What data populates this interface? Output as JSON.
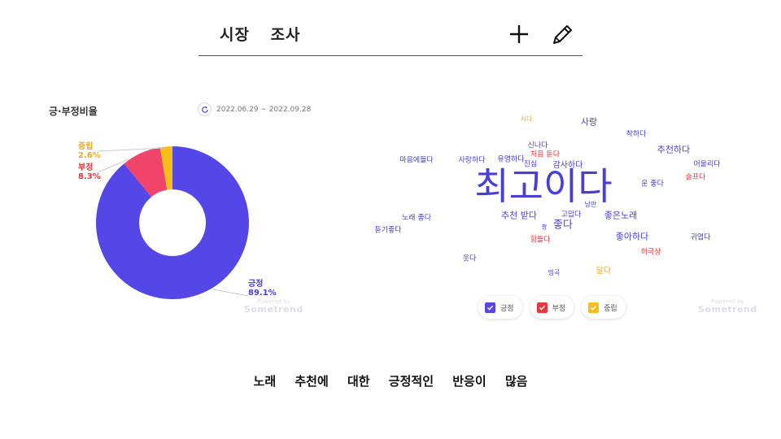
{
  "header": {
    "title": "시장 조사"
  },
  "sentiment_panel": {
    "title": "긍·부정비율",
    "date_range": "2022.06.29 ~ 2022.09.28"
  },
  "chart_data": [
    {
      "type": "pie",
      "title": "긍·부정비율",
      "slices": [
        {
          "label": "긍정",
          "value": 89.1,
          "value_label": "89.1%",
          "color": "#5546e8"
        },
        {
          "label": "부정",
          "value": 8.3,
          "value_label": "8.3%",
          "color": "#f0446b"
        },
        {
          "label": "중립",
          "value": 2.6,
          "value_label": "2.6%",
          "color": "#f5be18"
        }
      ]
    }
  ],
  "wordcloud": {
    "words": [
      {
        "text": "최고이다",
        "sentiment": "positive"
      },
      {
        "text": "좋다",
        "sentiment": "positive"
      },
      {
        "text": "시다",
        "sentiment": "neutral"
      },
      {
        "text": "사랑",
        "sentiment": "positive"
      },
      {
        "text": "착하다",
        "sentiment": "positive"
      },
      {
        "text": "신나다",
        "sentiment": "positive"
      },
      {
        "text": "추천하다",
        "sentiment": "positive"
      },
      {
        "text": "처음 듣다",
        "sentiment": "negative"
      },
      {
        "text": "마음에들다",
        "sentiment": "positive"
      },
      {
        "text": "사랑하다",
        "sentiment": "positive"
      },
      {
        "text": "유명하다",
        "sentiment": "positive"
      },
      {
        "text": "진심",
        "sentiment": "positive"
      },
      {
        "text": "감사하다",
        "sentiment": "positive"
      },
      {
        "text": "어울리다",
        "sentiment": "positive"
      },
      {
        "text": "슬프다",
        "sentiment": "negative"
      },
      {
        "text": "운 좋다",
        "sentiment": "positive"
      },
      {
        "text": "낭만",
        "sentiment": "positive"
      },
      {
        "text": "추천 받다",
        "sentiment": "positive"
      },
      {
        "text": "고맙다",
        "sentiment": "positive"
      },
      {
        "text": "좋은노래",
        "sentiment": "positive"
      },
      {
        "text": "노래 좋다",
        "sentiment": "positive"
      },
      {
        "text": "짱",
        "sentiment": "positive"
      },
      {
        "text": "듣기좋다",
        "sentiment": "positive"
      },
      {
        "text": "좋아하다",
        "sentiment": "positive"
      },
      {
        "text": "힘들다",
        "sentiment": "negative"
      },
      {
        "text": "귀엽다",
        "sentiment": "positive"
      },
      {
        "text": "허극상",
        "sentiment": "negative"
      },
      {
        "text": "웃다",
        "sentiment": "positive"
      },
      {
        "text": "띵곡",
        "sentiment": "positive"
      },
      {
        "text": "달다",
        "sentiment": "neutral"
      }
    ],
    "legend": [
      {
        "label": "긍정",
        "color": "#5546e8"
      },
      {
        "label": "부정",
        "color": "#e6373f"
      },
      {
        "label": "중립",
        "color": "#f5be18"
      }
    ]
  },
  "watermark": {
    "line1": "Powered by",
    "line2": "Sometrend"
  },
  "sentiment_colors": {
    "positive": "#4a3fd4",
    "negative": "#e6373f",
    "neutral": "#f0a818"
  },
  "footer": {
    "caption": "노래 추천에 대한 긍정적인 반응이 많음"
  }
}
